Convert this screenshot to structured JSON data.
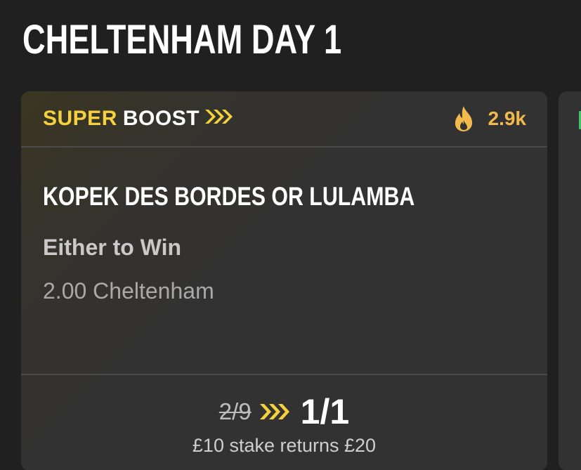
{
  "page": {
    "title": "CHELTENHAM DAY 1"
  },
  "card": {
    "boost": {
      "super_label": "SUPER",
      "boost_label": "BOOST"
    },
    "popularity": {
      "icon": "flame-icon",
      "count": "2.9k"
    },
    "selection": "KOPEK DES BORDES OR LULAMBA",
    "market": "Either to Win",
    "event": "2.00 Cheltenham",
    "odds": {
      "was": "2/9",
      "now": "1/1"
    },
    "returns_text": "£10 stake returns £20"
  },
  "colors": {
    "background": "#202020",
    "card": "#323232",
    "accent_yellow": "#f5d23d",
    "heat_orange": "#f2b94d",
    "next_card_accent": "#3fc46a"
  }
}
